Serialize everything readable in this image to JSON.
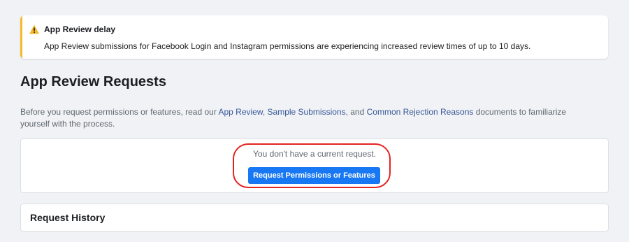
{
  "alert": {
    "title": "App Review delay",
    "message": "App Review submissions for Facebook Login and Instagram permissions are experiencing increased review times of up to 10 days.",
    "icon": "warning-icon",
    "accent_color": "#f7b928"
  },
  "page": {
    "title": "App Review Requests"
  },
  "intro": {
    "prefix": "Before you request permissions or features, read our ",
    "link_app_review": "App Review",
    "sep1": ", ",
    "link_sample_submissions": "Sample Submissions",
    "sep2": ", and ",
    "link_common_rejection": "Common Rejection Reasons",
    "suffix": " documents to familiarize yourself with the process."
  },
  "current_request": {
    "empty_text": "You don't have a current request.",
    "button_label": "Request Permissions or Features",
    "button_color": "#1877f2",
    "highlight_color": "#e4231f"
  },
  "history": {
    "title": "Request History"
  }
}
